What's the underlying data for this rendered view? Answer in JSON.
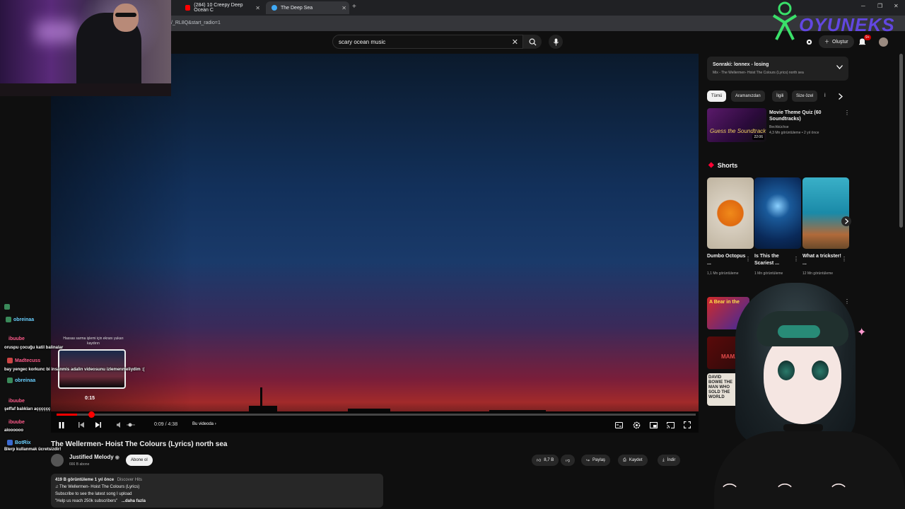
{
  "browser": {
    "tabs": [
      {
        "label": "(284) 10 Creepy Deep Ocean C",
        "favicon_color": "#ff0000"
      },
      {
        "label": "The Deep Sea",
        "favicon_color": "#3fa9f5"
      }
    ],
    "url": "/_RL8Q&start_radio=1"
  },
  "header": {
    "search_query": "scary ocean music",
    "create_label": "Oluştur",
    "notification_count": "9+"
  },
  "overlay": {
    "logo_text": "OYUNEKS"
  },
  "player": {
    "seek_hint": "Hassas sarma işlemi için ekranı yukarı kaydırın",
    "seek_time": "0:15",
    "current_time": "0:09 / 4:38",
    "chapter_label": "Bu videoda",
    "progress_fraction": 0.032,
    "hover_fraction": 0.054
  },
  "video": {
    "title": "The Wellermen- Hoist The Colours (Lyrics) north sea",
    "channel": "Justified Melody",
    "subscribers": "666 B abone",
    "subscribe_label": "Abone ol",
    "likes": "8,7 B",
    "share_label": "Paylaş",
    "save_label": "Kaydet",
    "download_label": "İndir",
    "description": {
      "views": "419 B görüntüleme",
      "age": "1 yıl önce",
      "tag": "Discover Hits",
      "line2": "♫ The Wellermen- Hoist The Colours (Lyrics)",
      "line3": "Subscribe to see the latest song I upload",
      "line4": "\"Help us reach 250k subscribers\"",
      "more": "...daha fazla"
    }
  },
  "chat": [
    {
      "name": "obreinaa",
      "color": "#6ad0ff",
      "message": ""
    },
    {
      "name": "ibuube",
      "color": "#ff5a8a",
      "message": "oruspu çocuğu katil balinalar"
    },
    {
      "name": "Madtecuss",
      "color": "#ff5a8a",
      "message": "bay yengec korkunc bi insanmis adalin videosunu izlemenmeliydim :("
    },
    {
      "name": "obreinaa",
      "color": "#6ad0ff",
      "message": ""
    },
    {
      "name": "ibuube",
      "color": "#ff5a8a",
      "message": "şeffaf balıkları açççççç"
    },
    {
      "name": "ibuube",
      "color": "#ff5a8a",
      "message": "aloooooo"
    },
    {
      "name": "BotRix",
      "color": "#6ad0ff",
      "message": "Blerp kullanmak ücretsizdir!"
    }
  ],
  "sidebar": {
    "playlist_next": "Sonraki: lonnex - losing",
    "playlist_sub": "Mix - The Wellermen- Hoist The Colours (Lyrics) north sea",
    "chips": [
      "Tümü",
      "Aramanızdan",
      "İlgili",
      "Size özel",
      "İ"
    ],
    "rec": {
      "title": "Movie Theme Quiz (60 Soundtracks)",
      "channel": "Bechbüchse",
      "meta": "4,3 Mn görüntüleme • 2 yıl önce",
      "duration": "22:06",
      "thumb_text": "Guess the Soundtrack"
    },
    "shorts_label": "Shorts",
    "shorts": [
      {
        "title": "Dumbo Octopus ...",
        "views": "1,1 Mn görüntüleme"
      },
      {
        "title": "Is This the Scariest ...",
        "views": "1 Mn görüntüleme"
      },
      {
        "title": "What a trickster! ...",
        "views": "12 Mn görüntüleme"
      }
    ],
    "bottom_thumbs": [
      "A Bear in the",
      "MAMA",
      "DAVID BOWIE THE MAN WHO SOLD THE WORLD"
    ]
  }
}
